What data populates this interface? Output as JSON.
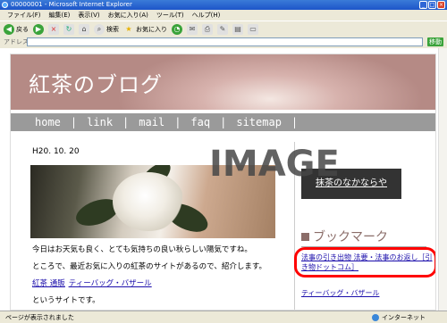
{
  "window": {
    "title": "00000001 - Microsoft Internet Explorer"
  },
  "menu": [
    "ファイル(F)",
    "編集(E)",
    "表示(V)",
    "お気に入り(A)",
    "ツール(T)",
    "ヘルプ(H)"
  ],
  "toolbar": {
    "back": "戻る",
    "search": "検索",
    "favorites": "お気に入り"
  },
  "address": {
    "label": "アドレス(D)",
    "value": "",
    "go": "移動"
  },
  "site": {
    "title": "紅茶のブログ",
    "nav": [
      "home",
      "link",
      "mail",
      "faq",
      "sitemap"
    ]
  },
  "post": {
    "date": "H20. 10. 20",
    "p1": "今日はお天気も良く、とても気持ちの良い秋らしい陽気ですね。",
    "p2": "ところで、最近お気に入りの紅茶のサイトがあるので、紹介します。",
    "link1": "紅茶 通販",
    "link2": "ティーバッグ・バザール",
    "p3": "というサイトです。"
  },
  "sidebar": {
    "box_link": "抹茶のなかならや",
    "bookmark_title": "ブックマーク",
    "bm_link1": "法事の引き出物 法要・法事のお返し［引き物ドットコム］",
    "bm_link2": "ティーバッグ・バザール"
  },
  "watermark": "IMAGE",
  "status": {
    "left": "ページが表示されました",
    "zone": "インターネット"
  }
}
